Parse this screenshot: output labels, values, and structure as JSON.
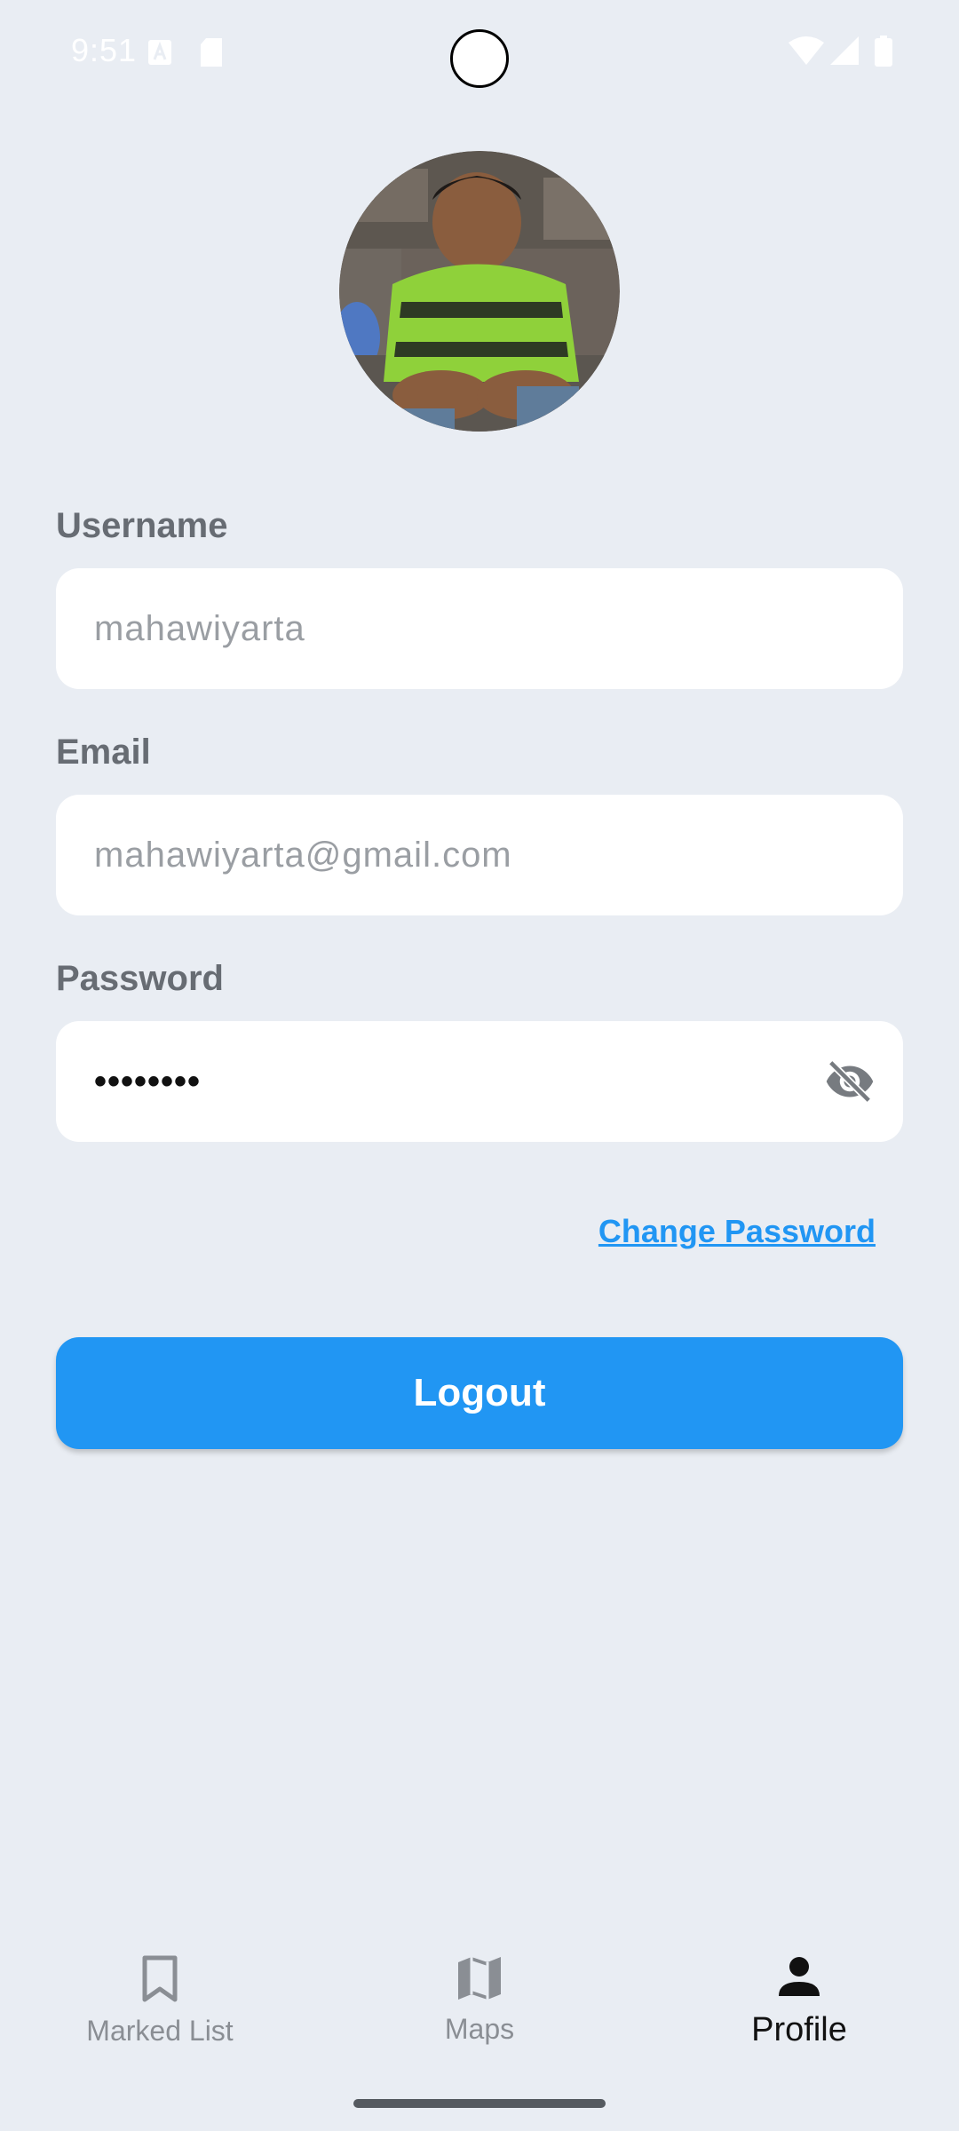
{
  "status_bar": {
    "time": "9:51",
    "icons": [
      "font-icon",
      "sd-card-icon",
      "wifi-icon",
      "signal-icon",
      "battery-icon"
    ]
  },
  "profile": {
    "avatar_icon": "profile-photo",
    "username_label": "Username",
    "username_value": "mahawiyarta",
    "email_label": "Email",
    "email_value": "mahawiyarta@gmail.com",
    "password_label": "Password",
    "password_value": "••••••••",
    "visibility_icon": "eye-off-icon",
    "change_password_label": "Change Password",
    "logout_label": "Logout"
  },
  "bottom_nav": {
    "items": [
      {
        "label": "Marked List",
        "icon": "bookmark-icon",
        "active": false
      },
      {
        "label": "Maps",
        "icon": "map-icon",
        "active": false
      },
      {
        "label": "Profile",
        "icon": "person-icon",
        "active": true
      }
    ]
  },
  "colors": {
    "background": "#e9edf3",
    "accent": "#2196f3",
    "label": "#676c73"
  }
}
